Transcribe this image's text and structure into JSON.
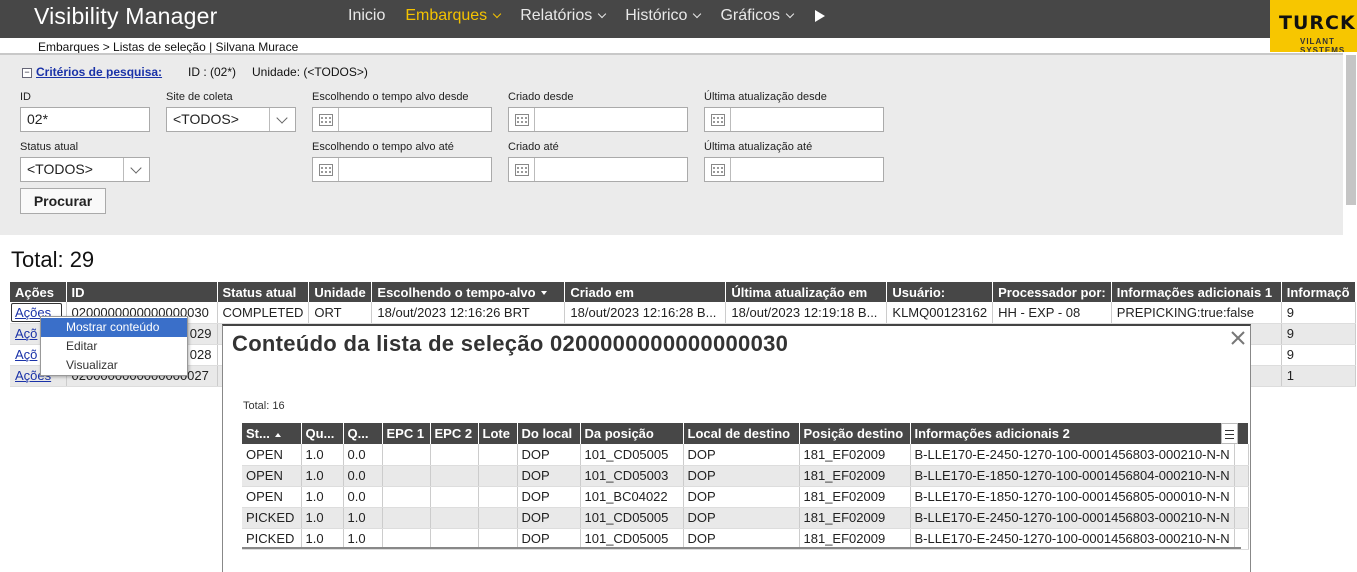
{
  "app": {
    "title": "Visibility Manager"
  },
  "nav": {
    "items": [
      {
        "label": "Inicio"
      },
      {
        "label": "Embarques"
      },
      {
        "label": "Relatórios"
      },
      {
        "label": "Histórico"
      },
      {
        "label": "Gráficos"
      }
    ],
    "active_color": "#f4c200"
  },
  "logo": {
    "word": "TURCK",
    "tagline": "VILANT SYSTEMS"
  },
  "breadcrumb": "Embarques > Listas de seleção | Silvana Murace",
  "criteria": {
    "link_label": "Critérios de pesquisa:",
    "id_summary": "ID : (02*)",
    "unit_summary": "Unidade: (<TODOS>)",
    "fields": {
      "id_label": "ID",
      "id_value": "02*",
      "site_label": "Site de coleta",
      "site_value": "<TODOS>",
      "target_from_label": "Escolhendo o tempo alvo desde",
      "created_from_label": "Criado desde",
      "updated_from_label": "Última atualização desde",
      "status_label": "Status atual",
      "status_value": "<TODOS>",
      "target_to_label": "Escolhendo o tempo alvo até",
      "created_to_label": "Criado até",
      "updated_to_label": "Última atualização até"
    },
    "search_button": "Procurar"
  },
  "results": {
    "total": "Total: 29",
    "columns": [
      "Ações",
      "ID",
      "Status atual",
      "Unidade",
      "Escolhendo o tempo-alvo",
      "Criado em",
      "Última atualização em",
      "Usuário:",
      "Processador por:",
      "Informações adicionais 1",
      "Informaçõ"
    ],
    "rows": [
      [
        "Ações",
        "0200000000000000030",
        "COMPLETED",
        "ORT",
        "18/out/2023 12:16:26 BRT",
        "18/out/2023 12:16:28 B...",
        "18/out/2023 12:19:18 B...",
        "KLMQ00123162",
        "HH - EXP - 08",
        "PREPICKING:true:false",
        "9"
      ],
      [
        "Açõ",
        "029",
        "",
        "",
        "",
        "",
        "",
        "",
        "",
        "",
        "9"
      ],
      [
        "Açõ",
        "028",
        "",
        "",
        "",
        "",
        "",
        "",
        "",
        "",
        "9"
      ],
      [
        "Ações",
        "0200000000000000027",
        "",
        "",
        "",
        "",
        "",
        "",
        "",
        "",
        "1"
      ]
    ]
  },
  "context_menu": {
    "items": [
      "Mostrar conteúdo",
      "Editar",
      "Visualizar"
    ]
  },
  "modal": {
    "title": "Conteúdo da lista de seleção 0200000000000000030",
    "total": "Total: 16",
    "columns": [
      "St...",
      "Qu...",
      "Q...",
      "EPC 1",
      "EPC 2",
      "Lote",
      "Do local",
      "Da posição",
      "Local de destino",
      "Posição destino",
      "Informações adicionais 2"
    ],
    "rows": [
      [
        "OPEN",
        "1.0",
        "0.0",
        "",
        "",
        "",
        "DOP",
        "101_CD05005",
        "DOP",
        "181_EF02009",
        "B-LLE170-E-2450-1270-100-0001456803-000210-N-N"
      ],
      [
        "OPEN",
        "1.0",
        "0.0",
        "",
        "",
        "",
        "DOP",
        "101_CD05003",
        "DOP",
        "181_EF02009",
        "B-LLE170-E-1850-1270-100-0001456804-000210-N-N"
      ],
      [
        "OPEN",
        "1.0",
        "0.0",
        "",
        "",
        "",
        "DOP",
        "101_BC04022",
        "DOP",
        "181_EF02009",
        "B-LLE170-E-1850-1270-100-0001456805-000010-N-N"
      ],
      [
        "PICKED",
        "1.0",
        "1.0",
        "",
        "",
        "",
        "DOP",
        "101_CD05005",
        "DOP",
        "181_EF02009",
        "B-LLE170-E-2450-1270-100-0001456803-000210-N-N"
      ],
      [
        "PICKED",
        "1.0",
        "1.0",
        "",
        "",
        "",
        "DOP",
        "101_CD05005",
        "DOP",
        "181_EF02009",
        "B-LLE170-E-2450-1270-100-0001456803-000210-N-N"
      ]
    ]
  }
}
